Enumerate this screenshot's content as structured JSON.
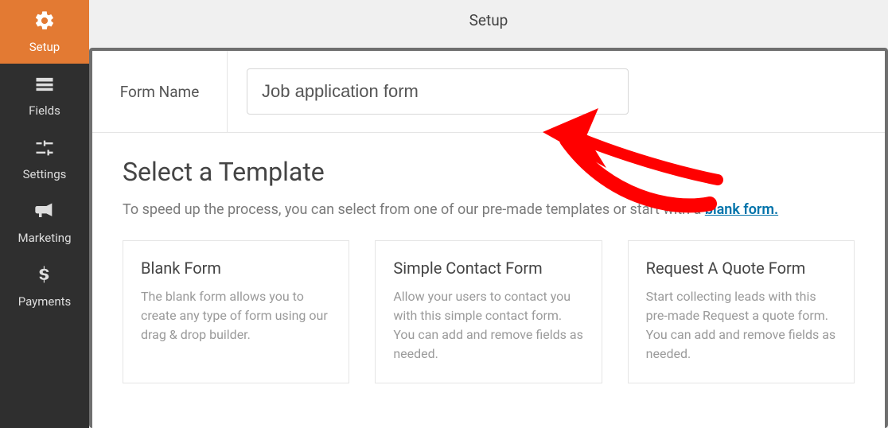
{
  "header": {
    "title": "Setup"
  },
  "sidebar": {
    "items": [
      {
        "name": "setup",
        "label": "Setup",
        "active": true
      },
      {
        "name": "fields",
        "label": "Fields",
        "active": false
      },
      {
        "name": "settings",
        "label": "Settings",
        "active": false
      },
      {
        "name": "marketing",
        "label": "Marketing",
        "active": false
      },
      {
        "name": "payments",
        "label": "Payments",
        "active": false
      }
    ]
  },
  "form_name": {
    "label": "Form Name",
    "value": "Job application form"
  },
  "templates": {
    "heading": "Select a Template",
    "lead_prefix": "To speed up the process, you can select from one of our pre-made templates or start with a ",
    "lead_link_text": "blank form.",
    "cards": [
      {
        "title": "Blank Form",
        "desc": "The blank form allows you to create any type of form using our drag & drop builder."
      },
      {
        "title": "Simple Contact Form",
        "desc": "Allow your users to contact you with this simple contact form. You can add and remove fields as needed."
      },
      {
        "title": "Request A Quote Form",
        "desc": "Start collecting leads with this pre-made Request a quote form. You can add and remove fields as needed."
      }
    ]
  }
}
